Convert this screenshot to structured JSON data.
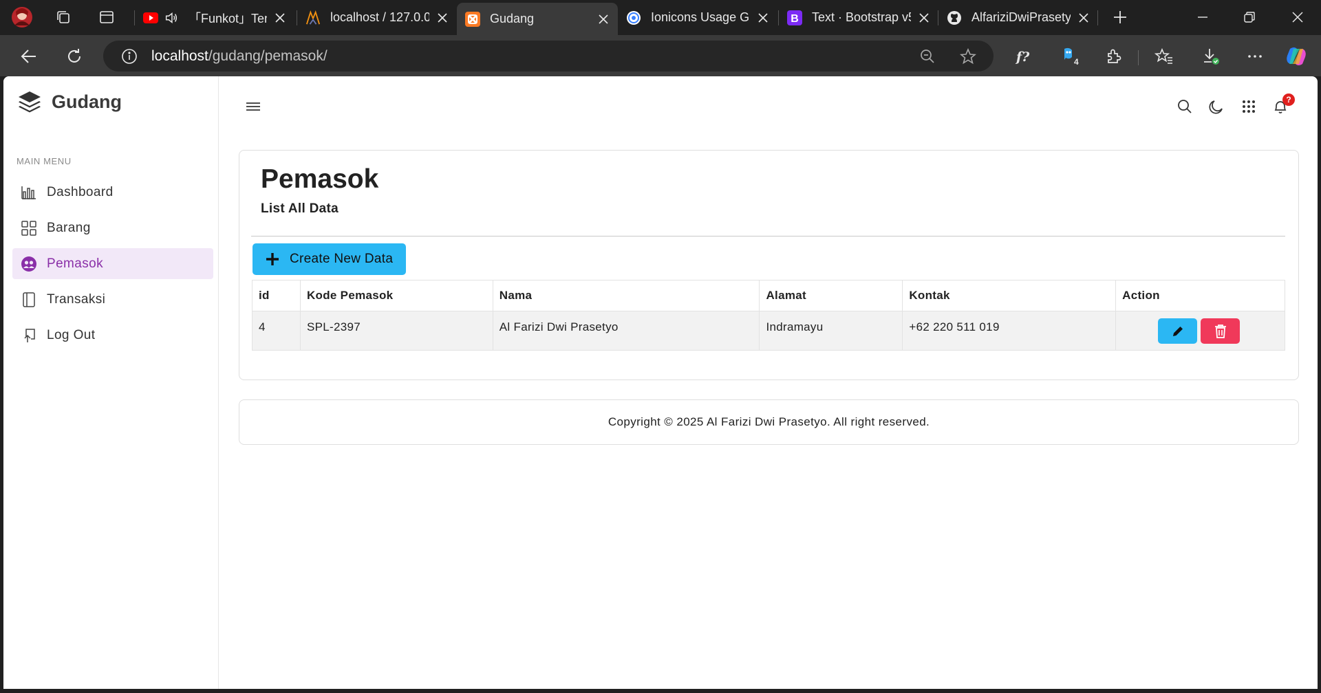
{
  "browser": {
    "tabs": [
      {
        "title": "「Funkot」Ten",
        "favicon": "youtube-icon"
      },
      {
        "title": "localhost / 127.0.0",
        "favicon": "phpmyadmin-icon"
      },
      {
        "title": "Gudang",
        "favicon": "xampp-icon"
      },
      {
        "title": "Ionicons Usage Gu",
        "favicon": "ionicons-icon"
      },
      {
        "title": "Text · Bootstrap v5",
        "favicon": "bootstrap-icon"
      },
      {
        "title": "AlfariziDwiPrasety",
        "favicon": "github-icon"
      }
    ],
    "url_host": "localhost",
    "url_path": "/gudang/pemasok/",
    "extension_badge": "4"
  },
  "app": {
    "brand": "Gudang",
    "menu_heading": "MAIN MENU",
    "menu": [
      {
        "label": "Dashboard",
        "icon": "bar-chart-icon"
      },
      {
        "label": "Barang",
        "icon": "grid-icon"
      },
      {
        "label": "Pemasok",
        "icon": "people-icon",
        "active": true
      },
      {
        "label": "Transaksi",
        "icon": "book-icon"
      },
      {
        "label": "Log Out",
        "icon": "logout-icon"
      }
    ],
    "notification_count": "?"
  },
  "main": {
    "title": "Pemasok",
    "subtitle": "List All Data",
    "create_button": "Create New Data",
    "table": {
      "headers": [
        "id",
        "Kode Pemasok",
        "Nama",
        "Alamat",
        "Kontak",
        "Action"
      ],
      "rows": [
        [
          "4",
          "SPL-2397",
          "Al Farizi Dwi Prasetyo",
          "Indramayu",
          "+62 220 511 019"
        ]
      ]
    }
  },
  "footer": {
    "text": "Copyright © 2025 Al Farizi Dwi Prasetyo. All right reserved."
  },
  "colors": {
    "accent": "#2bb7f3",
    "danger": "#f0395a",
    "active_menu_bg": "#f2e8f8",
    "active_menu_text": "#8a2fa8"
  }
}
